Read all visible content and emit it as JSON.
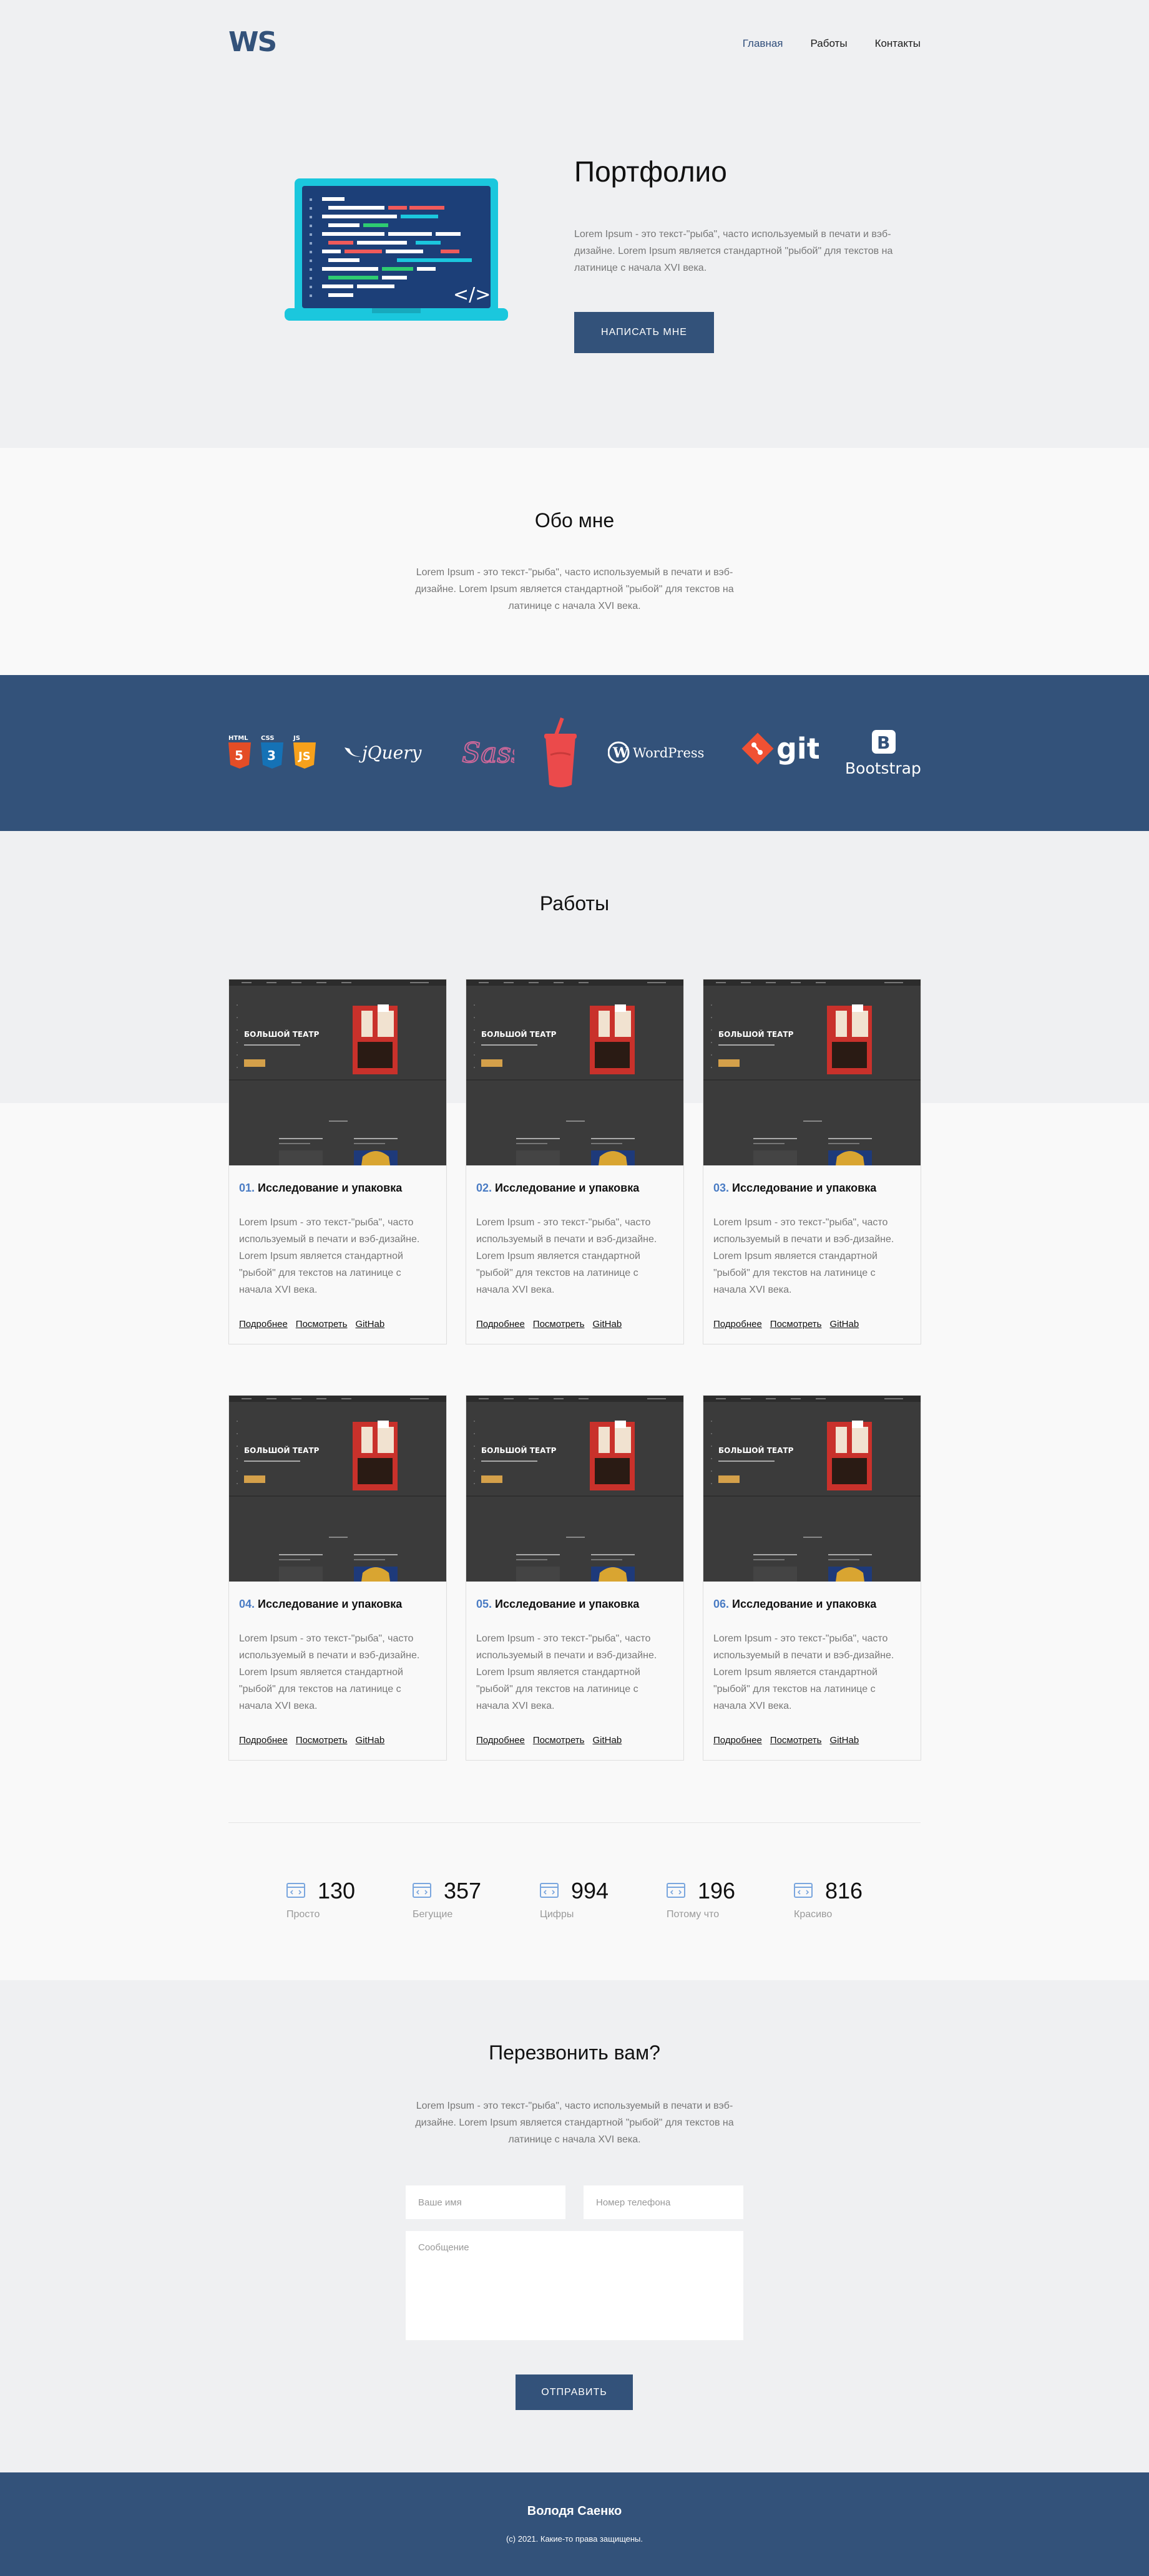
{
  "header": {
    "logo_text": "WS",
    "nav": [
      {
        "label": "Главная",
        "active": true
      },
      {
        "label": "Работы",
        "active": false
      },
      {
        "label": "Контакты",
        "active": false
      }
    ]
  },
  "hero": {
    "title": "Портфолио",
    "text": "Lorem Ipsum - это текст-\"рыба\", часто используемый в печати и вэб-дизайне. Lorem Ipsum является стандартной \"рыбой\" для текстов на латинице с начала XVI века.",
    "button": "НАПИСАТЬ МНЕ",
    "laptop_code_symbol": "</>"
  },
  "about": {
    "title": "Обо мне",
    "text": "Lorem Ipsum - это текст-\"рыба\", часто используемый в печати и вэб-дизайне. Lorem Ipsum является стандартной \"рыбой\" для текстов на латинице с начала XVI века."
  },
  "tech": {
    "html_labels": [
      "HTML",
      "CSS",
      "JS"
    ],
    "jquery": "jQuery",
    "sass": "Sass",
    "wordpress": "WordPress",
    "git": "git",
    "bootstrap": "Bootstrap",
    "bootstrap_letter": "B"
  },
  "works": {
    "title": "Работы",
    "screenshot_heading": "БОЛЬШОЙ ТЕАТР",
    "items": [
      {
        "num": "01.",
        "title": "Исследование и упаковка",
        "text": "Lorem Ipsum - это текст-\"рыба\", часто используемый в печати и вэб-дизайне. Lorem Ipsum является стандартной \"рыбой\" для текстов на латинице с начала XVI века.",
        "links": [
          "Подробнее",
          "Посмотреть",
          "GitHab"
        ]
      },
      {
        "num": "02.",
        "title": "Исследование и упаковка",
        "text": "Lorem Ipsum - это текст-\"рыба\", часто используемый в печати и вэб-дизайне. Lorem Ipsum является стандартной \"рыбой\" для текстов на латинице с начала XVI века.",
        "links": [
          "Подробнее",
          "Посмотреть",
          "GitHab"
        ]
      },
      {
        "num": "03.",
        "title": "Исследование и упаковка",
        "text": "Lorem Ipsum - это текст-\"рыба\", часто используемый в печати и вэб-дизайне. Lorem Ipsum является стандартной \"рыбой\" для текстов на латинице с начала XVI века.",
        "links": [
          "Подробнее",
          "Посмотреть",
          "GitHab"
        ]
      },
      {
        "num": "04.",
        "title": "Исследование и упаковка",
        "text": "Lorem Ipsum - это текст-\"рыба\", часто используемый в печати и вэб-дизайне. Lorem Ipsum является стандартной \"рыбой\" для текстов на латинице с начала XVI века.",
        "links": [
          "Подробнее",
          "Посмотреть",
          "GitHab"
        ]
      },
      {
        "num": "05.",
        "title": "Исследование и упаковка",
        "text": "Lorem Ipsum - это текст-\"рыба\", часто используемый в печати и вэб-дизайне. Lorem Ipsum является стандартной \"рыбой\" для текстов на латинице с начала XVI века.",
        "links": [
          "Подробнее",
          "Посмотреть",
          "GitHab"
        ]
      },
      {
        "num": "06.",
        "title": "Исследование и упаковка",
        "text": "Lorem Ipsum - это текст-\"рыба\", часто используемый в печати и вэб-дизайне. Lorem Ipsum является стандартной \"рыбой\" для текстов на латинице с начала XVI века.",
        "links": [
          "Подробнее",
          "Посмотреть",
          "GitHab"
        ]
      }
    ]
  },
  "stats": [
    {
      "value": "130",
      "label": "Просто",
      "icon": "browser-code-icon"
    },
    {
      "value": "357",
      "label": "Бегущие",
      "icon": "browser-code-icon"
    },
    {
      "value": "994",
      "label": "Цифры",
      "icon": "browser-code-icon"
    },
    {
      "value": "196",
      "label": "Потому что",
      "icon": "browser-code-icon"
    },
    {
      "value": "816",
      "label": "Красиво",
      "icon": "browser-code-icon"
    }
  ],
  "callback": {
    "title": "Перезвонить вам?",
    "text": "Lorem Ipsum - это текст-\"рыба\", часто используемый в печати и вэб-дизайне. Lorem Ipsum является стандартной \"рыбой\" для текстов на латинице с начала XVI века.",
    "name_placeholder": "Ваше имя",
    "phone_placeholder": "Номер телефона",
    "message_placeholder": "Сообщение",
    "button": "ОТПРАВИТЬ"
  },
  "footer": {
    "name": "Володя Саенко",
    "copyright": "(c) 2021. Какие-то права защищены."
  },
  "colors": {
    "primary": "#33527a",
    "accent_number": "#4a7cc4",
    "bg_light": "#eff0f2",
    "bg_white": "#f9f9f9"
  }
}
